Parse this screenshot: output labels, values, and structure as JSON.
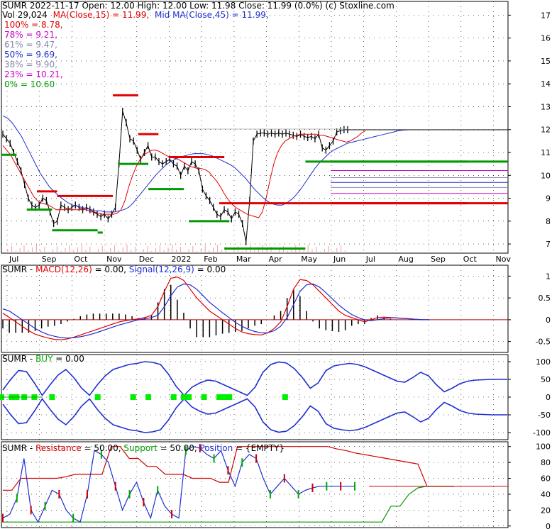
{
  "colors": {
    "price": "#000000",
    "ma15": "#e00000",
    "ma45": "#1f2fd0",
    "fib100": "#e00000",
    "fib78": "#cc00cc",
    "fib61": "#8a8ab0",
    "fib50": "#1f2fd0",
    "fib38": "#8a8ab0",
    "fib23": "#cc00cc",
    "fib0": "#009900",
    "macd": "#e00000",
    "signal": "#1f2fd0",
    "buy": "#00ee00",
    "band": "#1f2fd0",
    "resistance": "#cc0000",
    "support": "#009900",
    "position": "#1f2fd0"
  },
  "header": {
    "line1": "SUMR  2022-11-17 Open: 12.00  High: 12.00  Low: 11.98  Close: 11.99 (0.0%)  (c) Stoxline.com",
    "vol": "Vol 29,024",
    "ma15": "MA(Close,15) = 11.99,",
    "ma45": "Mid MA(Close,45) = 11.99,"
  },
  "fib_legend": [
    {
      "label": "100% = 8.78,",
      "color": "#e00000"
    },
    {
      "label": "78% = 9.21,",
      "color": "#cc00cc"
    },
    {
      "label": "61% = 9.47,",
      "color": "#8a8ab0"
    },
    {
      "label": "50% = 9.69,",
      "color": "#1f2fd0"
    },
    {
      "label": "38% = 9.90,",
      "color": "#8a8ab0"
    },
    {
      "label": "23% = 10.21,",
      "color": "#cc00cc"
    },
    {
      "label": "0% = 10.60",
      "color": "#009900"
    }
  ],
  "panels": {
    "macd": {
      "prefix": "SUMR - ",
      "name": "MACD(12,26)",
      "value": " = 0.00,  ",
      "sig": "Signal(12,26,9)",
      "sigval": " = 0.00"
    },
    "buy": {
      "prefix": "SUMR - ",
      "name": "BUY",
      "value": " = 0.00"
    },
    "rsp": {
      "prefix": "SUMR - ",
      "res": "Resistance",
      "resval": " = 50.00,  ",
      "sup": "Support",
      "supval": " = 50.00,  ",
      "pos": "Position",
      "posval": " = {EMPTY}"
    }
  },
  "chart_data": [
    {
      "type": "line",
      "title": "SUMR 2022-11-17",
      "ylim": [
        6.6,
        17.6
      ],
      "y_ticks": [
        7,
        8,
        9,
        10,
        11,
        12,
        13,
        14,
        15,
        16,
        17
      ],
      "x_labels": [
        "Jul",
        "Sep",
        "Oct",
        "Nov",
        "Dec",
        "2022",
        "Feb",
        "Mar",
        "Apr",
        "May",
        "Jun",
        "Jul",
        "Aug",
        "Sep",
        "Oct",
        "Nov"
      ],
      "last_close": 11.99,
      "price": [
        11.8,
        11.6,
        11.4,
        11.0,
        10.6,
        10.2,
        9.6,
        9.0,
        8.7,
        8.6,
        8.7,
        9.0,
        8.9,
        8.4,
        7.9,
        8.0,
        8.7,
        8.6,
        8.5,
        8.6,
        8.7,
        8.6,
        8.5,
        8.6,
        8.5,
        8.4,
        8.3,
        8.2,
        8.3,
        8.1,
        8.3,
        8.6,
        10.5,
        12.8,
        12.3,
        11.6,
        11.5,
        11.1,
        10.7,
        11.0,
        11.3,
        10.8,
        10.8,
        10.6,
        10.5,
        10.6,
        10.7,
        10.5,
        10.4,
        10.0,
        10.4,
        10.2,
        10.6,
        10.5,
        10.2,
        9.4,
        9.1,
        8.9,
        8.6,
        8.3,
        8.2,
        8.5,
        8.4,
        8.1,
        8.4,
        8.3,
        7.9,
        7.1,
        8.9,
        11.5,
        11.8,
        11.85,
        11.85,
        11.8,
        11.85,
        11.8,
        11.85,
        11.8,
        11.85,
        11.8,
        11.75,
        11.7,
        11.8,
        11.7,
        11.65,
        11.7,
        11.6,
        11.8,
        11.2,
        11.1,
        11.3,
        11.5,
        11.9,
        11.95,
        12.0,
        11.99
      ],
      "ma15": [
        11.3,
        11.1,
        10.9,
        10.6,
        10.3,
        10.0,
        9.7,
        9.4,
        9.1,
        8.9,
        8.8,
        8.75,
        8.7,
        8.6,
        8.5,
        8.5,
        8.5,
        8.5,
        8.5,
        8.5,
        8.5,
        8.5,
        8.5,
        8.4,
        8.4,
        8.35,
        8.3,
        8.3,
        8.3,
        8.3,
        8.35,
        8.5,
        8.9,
        9.5,
        10.0,
        10.4,
        10.7,
        10.9,
        11.0,
        11.1,
        11.1,
        11.05,
        10.95,
        10.85,
        10.8,
        10.75,
        10.7,
        10.6,
        10.5,
        10.4,
        10.35,
        10.3,
        10.3,
        10.25,
        10.15,
        9.95,
        9.75,
        9.5,
        9.2,
        8.95,
        8.75,
        8.6,
        8.5,
        8.4,
        8.3,
        8.25,
        8.2,
        8.15,
        8.4,
        9.0,
        9.8,
        10.5,
        11.0,
        11.3,
        11.5,
        11.6,
        11.7,
        11.75,
        11.8,
        11.8,
        11.8,
        11.8,
        11.8,
        11.75,
        11.75,
        11.7,
        11.65,
        11.6,
        11.55,
        11.5,
        11.45,
        11.5,
        11.6,
        11.7,
        11.85,
        11.95
      ],
      "ma45": [
        12.6,
        12.5,
        12.3,
        12.0,
        11.7,
        11.3,
        10.9,
        10.5,
        10.1,
        9.8,
        9.5,
        9.3,
        9.1,
        8.95,
        8.8,
        8.7,
        8.65,
        8.6,
        8.55,
        8.5,
        8.45,
        8.45,
        8.4,
        8.4,
        8.4,
        8.45,
        8.5,
        8.6,
        8.8,
        9.05,
        9.3,
        9.55,
        9.8,
        10.05,
        10.25,
        10.45,
        10.6,
        10.7,
        10.8,
        10.85,
        10.9,
        10.95,
        10.95,
        10.95,
        10.9,
        10.85,
        10.75,
        10.65,
        10.55,
        10.45,
        10.3,
        10.1,
        9.9,
        9.65,
        9.4,
        9.2,
        9.0,
        8.85,
        8.75,
        8.7,
        8.7,
        8.8,
        8.95,
        9.15,
        9.4,
        9.7,
        10.0,
        10.3,
        10.55,
        10.75,
        10.95,
        11.1,
        11.2,
        11.3,
        11.4,
        11.45,
        11.5,
        11.55,
        11.6,
        11.65,
        11.7,
        11.75,
        11.8,
        11.85,
        11.9,
        11.95,
        11.98,
        11.99
      ],
      "fib_levels": [
        {
          "label": "100%",
          "value": 8.78,
          "color": "#e00000"
        },
        {
          "label": "78%",
          "value": 9.21,
          "color": "#cc00cc"
        },
        {
          "label": "61%",
          "value": 9.47,
          "color": "#8a8ab0"
        },
        {
          "label": "50%",
          "value": 9.69,
          "color": "#1f2fd0"
        },
        {
          "label": "38%",
          "value": 9.9,
          "color": "#8a8ab0"
        },
        {
          "label": "23%",
          "value": 10.21,
          "color": "#cc00cc"
        },
        {
          "label": "0%",
          "value": 10.6,
          "color": "#009900"
        }
      ],
      "red_levels": [
        {
          "from": 0.07,
          "to": 0.11,
          "value": 9.3
        },
        {
          "from": 0.11,
          "to": 0.22,
          "value": 9.1
        },
        {
          "from": 0.22,
          "to": 0.27,
          "value": 13.5
        },
        {
          "from": 0.27,
          "to": 0.31,
          "value": 11.8
        },
        {
          "from": 0.33,
          "to": 0.44,
          "value": 10.8
        },
        {
          "from": 0.43,
          "to": 0.6,
          "value": 8.78
        },
        {
          "from": 0.6,
          "to": 0.92,
          "value": 8.78
        }
      ],
      "green_levels": [
        {
          "from": 0.0,
          "to": 0.03,
          "value": 10.9
        },
        {
          "from": 0.05,
          "to": 0.1,
          "value": 8.5
        },
        {
          "from": 0.1,
          "to": 0.19,
          "value": 7.6
        },
        {
          "from": 0.19,
          "to": 0.2,
          "value": 7.5
        },
        {
          "from": 0.23,
          "to": 0.29,
          "value": 10.5
        },
        {
          "from": 0.29,
          "to": 0.36,
          "value": 9.4
        },
        {
          "from": 0.37,
          "to": 0.45,
          "value": 8.0
        },
        {
          "from": 0.44,
          "to": 0.6,
          "value": 6.8
        },
        {
          "from": 0.6,
          "to": 0.92,
          "value": 10.6
        }
      ]
    },
    {
      "type": "line",
      "title": "MACD(12,26)",
      "ylim": [
        -0.75,
        1.25
      ],
      "y_ticks": [
        -0.5,
        0.0,
        0.5,
        1.0
      ],
      "macd": [
        0.15,
        0.05,
        -0.05,
        -0.15,
        -0.25,
        -0.33,
        -0.38,
        -0.42,
        -0.45,
        -0.46,
        -0.44,
        -0.4,
        -0.35,
        -0.3,
        -0.25,
        -0.2,
        -0.15,
        -0.1,
        -0.05,
        -0.02,
        0.0,
        0.02,
        0.05,
        0.1,
        0.3,
        0.65,
        0.95,
        0.98,
        0.9,
        0.7,
        0.5,
        0.35,
        0.2,
        0.1,
        0.0,
        -0.1,
        -0.2,
        -0.28,
        -0.32,
        -0.34,
        -0.35,
        -0.3,
        -0.2,
        -0.05,
        0.3,
        0.7,
        0.92,
        0.9,
        0.8,
        0.65,
        0.5,
        0.35,
        0.2,
        0.1,
        0.05,
        0.0,
        -0.05,
        0.0,
        0.05,
        0.06,
        0.05,
        0.04,
        0.03,
        0.02,
        0.01,
        0.0,
        0.0
      ],
      "signal": [
        0.25,
        0.2,
        0.1,
        0.0,
        -0.1,
        -0.2,
        -0.28,
        -0.34,
        -0.38,
        -0.41,
        -0.42,
        -0.41,
        -0.39,
        -0.36,
        -0.32,
        -0.27,
        -0.22,
        -0.17,
        -0.12,
        -0.08,
        -0.04,
        0.0,
        0.02,
        0.05,
        0.1,
        0.3,
        0.55,
        0.75,
        0.82,
        0.8,
        0.7,
        0.55,
        0.4,
        0.28,
        0.16,
        0.05,
        -0.06,
        -0.15,
        -0.22,
        -0.27,
        -0.3,
        -0.3,
        -0.25,
        -0.15,
        0.05,
        0.35,
        0.65,
        0.8,
        0.82,
        0.75,
        0.62,
        0.48,
        0.34,
        0.22,
        0.12,
        0.05,
        0.0,
        -0.02,
        0.0,
        0.03,
        0.04,
        0.04,
        0.03,
        0.02,
        0.01,
        0.0,
        0.0
      ]
    },
    {
      "type": "line",
      "title": "BUY",
      "ylim": [
        -120,
        120
      ],
      "y_ticks": [
        -100,
        -50,
        0,
        50,
        100
      ],
      "upper_band": [
        20,
        50,
        75,
        72,
        40,
        5,
        35,
        62,
        78,
        55,
        25,
        5,
        35,
        60,
        78,
        85,
        92,
        95,
        100,
        98,
        92,
        65,
        30,
        5,
        28,
        40,
        48,
        45,
        35,
        25,
        15,
        5,
        28,
        70,
        92,
        99,
        96,
        80,
        55,
        25,
        40,
        75,
        88,
        92,
        95,
        92,
        85,
        75,
        65,
        55,
        45,
        42,
        55,
        70,
        60,
        35,
        15,
        25,
        38,
        45,
        48,
        49,
        50,
        50,
        50
      ],
      "buy_signals": [
        0.0,
        0.02,
        0.03,
        0.045,
        0.065,
        0.1,
        0.19,
        0.26,
        0.29,
        0.34,
        0.36,
        0.37,
        0.4,
        0.43,
        0.44,
        0.45,
        0.56
      ]
    },
    {
      "type": "line",
      "title": "Resistance / Support / Position",
      "ylim": [
        -2,
        106
      ],
      "y_ticks": [
        0,
        20,
        40,
        60,
        80,
        100
      ],
      "resistance": [
        45,
        45,
        60,
        60,
        60,
        60,
        60,
        62,
        65,
        65,
        65,
        65,
        100,
        100,
        85,
        85,
        75,
        75,
        65,
        65,
        65,
        60,
        60,
        60,
        55,
        55,
        100,
        100,
        100,
        100,
        100,
        100,
        100,
        100,
        100,
        100,
        100,
        97,
        95,
        92,
        90,
        88,
        86,
        84,
        82,
        80,
        78,
        50,
        50,
        50,
        50
      ],
      "support": [
        5,
        5,
        5,
        5,
        5,
        5,
        5,
        5,
        5,
        5,
        5,
        5,
        5,
        5,
        5,
        5,
        5,
        5,
        5,
        5,
        5,
        5,
        5,
        5,
        5,
        5,
        5,
        5,
        5,
        5,
        5,
        5,
        5,
        5,
        5,
        5,
        5,
        5,
        5,
        5,
        5,
        5,
        5,
        25,
        25,
        40,
        48,
        50,
        50,
        50,
        50
      ],
      "position": [
        10,
        15,
        35,
        85,
        20,
        5,
        25,
        45,
        40,
        20,
        10,
        5,
        40,
        95,
        90,
        80,
        50,
        20,
        40,
        55,
        30,
        10,
        45,
        25,
        15,
        10,
        95,
        100,
        98,
        90,
        85,
        95,
        70,
        50,
        80,
        90,
        85,
        60,
        40,
        50,
        60,
        50,
        40,
        45,
        48,
        50,
        50,
        50,
        50,
        50,
        50
      ]
    }
  ]
}
